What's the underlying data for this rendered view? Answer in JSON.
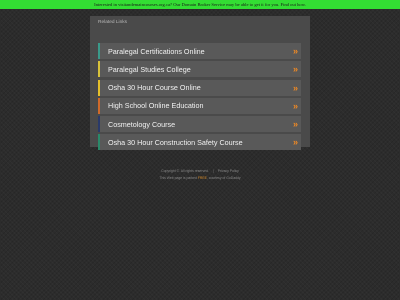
{
  "banner": {
    "text": "Interested in visitandemaincourses.org.ca? Our Domain Broker Service may be able to get it for you. Find out how."
  },
  "panel": {
    "title": "Related Links",
    "links": [
      {
        "label": "Paralegal Certifications Online",
        "color": "#3a9a8a"
      },
      {
        "label": "Paralegal Studies College",
        "color": "#d8c23a"
      },
      {
        "label": "Osha 30 Hour Course Online",
        "color": "#e6c02a"
      },
      {
        "label": "High School Online Education",
        "color": "#d06a2a"
      },
      {
        "label": "Cosmetology Course",
        "color": "#2a3a6a"
      },
      {
        "label": "Osha 30 Hour Construction Safety Course",
        "color": "#2a8a6a"
      }
    ],
    "arrow_glyph": "»",
    "arrow_color": "#f08a24"
  },
  "footer": {
    "copyright": "Copyright ©. All rights reserved.",
    "privacy": "Privacy Policy",
    "credit_prefix": "This Web page is parked",
    "credit_brand": "FREE",
    "credit_suffix": ", courtesy of GoDaddy"
  }
}
